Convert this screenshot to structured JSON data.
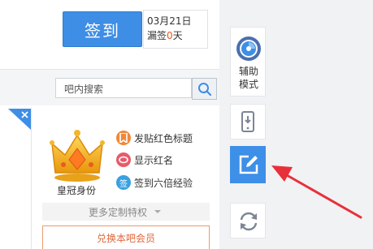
{
  "signin": {
    "label": "签到",
    "date": "03月21日",
    "missed_prefix": "漏签",
    "missed_count": "0",
    "missed_suffix": "天"
  },
  "search": {
    "placeholder": "吧内搜索"
  },
  "member": {
    "crown_label": "皇冠身份",
    "features": [
      {
        "text": "发贴红色标题",
        "icon": "title-icon",
        "color": "#f0883a"
      },
      {
        "text": "显示红名",
        "icon": "chat-icon",
        "color": "#e85a6a"
      },
      {
        "text": "签到六倍经验",
        "icon": "sign-icon",
        "color": "#3aa0e0",
        "icon_text": "签"
      }
    ],
    "more_label": "更多定制特权",
    "vip_button": "兑换本吧会员"
  },
  "sidebar": {
    "assist_label_1": "辅助",
    "assist_label_2": "模式"
  },
  "colors": {
    "primary": "#3e8ee6",
    "arrow": "#e8303a"
  }
}
